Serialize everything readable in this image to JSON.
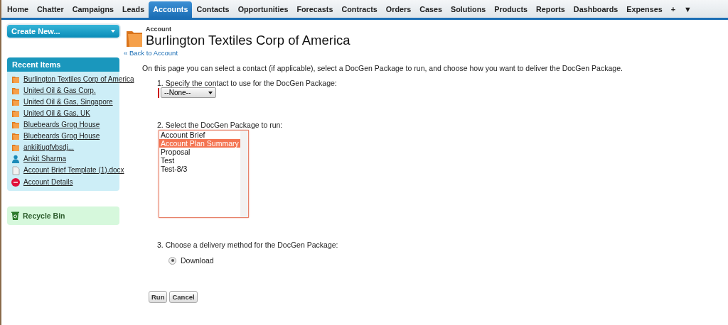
{
  "tabs": [
    {
      "label": "Home",
      "selected": false
    },
    {
      "label": "Chatter",
      "selected": false
    },
    {
      "label": "Campaigns",
      "selected": false
    },
    {
      "label": "Leads",
      "selected": false
    },
    {
      "label": "Accounts",
      "selected": true
    },
    {
      "label": "Contacts",
      "selected": false
    },
    {
      "label": "Opportunities",
      "selected": false
    },
    {
      "label": "Forecasts",
      "selected": false
    },
    {
      "label": "Contracts",
      "selected": false
    },
    {
      "label": "Orders",
      "selected": false
    },
    {
      "label": "Cases",
      "selected": false
    },
    {
      "label": "Solutions",
      "selected": false
    },
    {
      "label": "Products",
      "selected": false
    },
    {
      "label": "Reports",
      "selected": false
    },
    {
      "label": "Dashboards",
      "selected": false
    },
    {
      "label": "Expenses",
      "selected": false
    },
    {
      "label": "+",
      "selected": false
    },
    {
      "label": "▼",
      "selected": false
    }
  ],
  "sidebar": {
    "create_new": "Create New...",
    "recent_items": {
      "title": "Recent Items",
      "items": [
        {
          "label": "Burlington Textiles Corp of America",
          "kind": "account"
        },
        {
          "label": "United Oil & Gas Corp.",
          "kind": "account"
        },
        {
          "label": "United Oil & Gas, Singapore",
          "kind": "account"
        },
        {
          "label": "United Oil & Gas, UK",
          "kind": "account"
        },
        {
          "label": "Bluebeards Grog House",
          "kind": "account"
        },
        {
          "label": "Bluebeards Grog House",
          "kind": "account"
        },
        {
          "label": "ankiitiugfvbsdj...",
          "kind": "account"
        },
        {
          "label": "Ankit Sharma",
          "kind": "contact"
        },
        {
          "label": "Account Brief Template (1).docx",
          "kind": "document"
        },
        {
          "label": "Account Details",
          "kind": "other"
        }
      ]
    },
    "recycle_bin": "Recycle Bin"
  },
  "header": {
    "object_type": "Account",
    "title": "Burlington Textiles Corp of America",
    "back_link": "« Back to Account"
  },
  "intro": "On this page you can select a contact (if applicable), select a DocGen Package to run, and choose how you want to deliver the DocGen Package.",
  "steps": [
    {
      "number": "1.",
      "label": "Specify the contact to use for the DocGen Package:",
      "kind": "select",
      "value": "--None--"
    },
    {
      "number": "2.",
      "label": "Select the DocGen Package to run:",
      "kind": "listbox",
      "options": [
        {
          "label": "Account Brief",
          "selected": false
        },
        {
          "label": "Account Plan Summary",
          "selected": true
        },
        {
          "label": "Proposal",
          "selected": false
        },
        {
          "label": "Test",
          "selected": false
        },
        {
          "label": "Test-8/3",
          "selected": false
        }
      ]
    },
    {
      "number": "3.",
      "label": "Choose a delivery method for the DocGen Package:",
      "kind": "radio",
      "options": [
        {
          "label": "Download",
          "selected": true
        }
      ]
    }
  ],
  "buttons": [
    "Run",
    "Cancel"
  ]
}
